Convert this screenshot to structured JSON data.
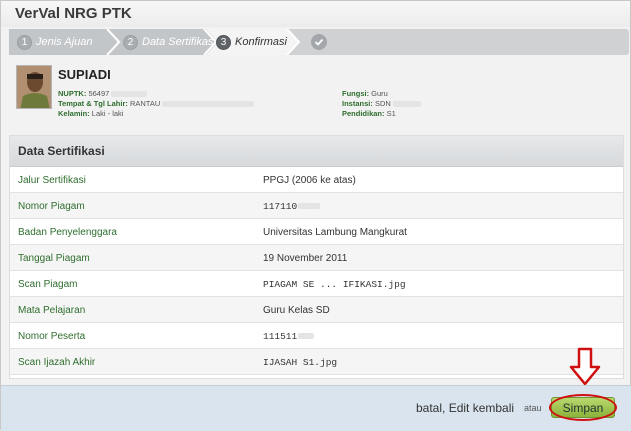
{
  "window": {
    "title": "VerVal NRG PTK"
  },
  "steps": [
    {
      "num": "1",
      "label": "Jenis Ajuan"
    },
    {
      "num": "2",
      "label": "Data Sertifikasi"
    },
    {
      "num": "3",
      "label": "Konfirmasi"
    }
  ],
  "profile": {
    "name": "SUPIADI",
    "nuptk_label": "NUPTK:",
    "nuptk_value": "56497",
    "ttl_label": "Tempat & Tgl Lahir:",
    "ttl_value": "RANTAU",
    "kelamin_label": "Kelamin:",
    "kelamin_value": "Laki - laki",
    "fungsi_label": "Fungsi:",
    "fungsi_value": "Guru",
    "instansi_label": "Instansi:",
    "instansi_value": "SDN",
    "pendidikan_label": "Pendidikan:",
    "pendidikan_value": "S1"
  },
  "panel": {
    "title": "Data Sertifikasi",
    "rows": [
      {
        "label": "Jalur Sertifikasi",
        "value": "PPGJ (2006 ke atas)"
      },
      {
        "label": "Nomor Piagam",
        "value": "117110"
      },
      {
        "label": "Badan Penyelenggara",
        "value": "Universitas Lambung Mangkurat"
      },
      {
        "label": "Tanggal Piagam",
        "value": "19 November 2011"
      },
      {
        "label": "Scan Piagam",
        "value": "PIAGAM SE ... IFIKASI.jpg"
      },
      {
        "label": "Mata Pelajaran",
        "value": "Guru Kelas SD"
      },
      {
        "label": "Nomor Peserta",
        "value": "111511"
      },
      {
        "label": "Scan Ijazah Akhir",
        "value": "IJASAH S1.jpg"
      }
    ]
  },
  "footer": {
    "batal": "batal, Edit kembali",
    "atau": "atau",
    "simpan": "Simpan"
  },
  "colors": {
    "accent_green": "#8cb33b",
    "label_green": "#2f6e2f",
    "annotation_red": "#d01010"
  }
}
